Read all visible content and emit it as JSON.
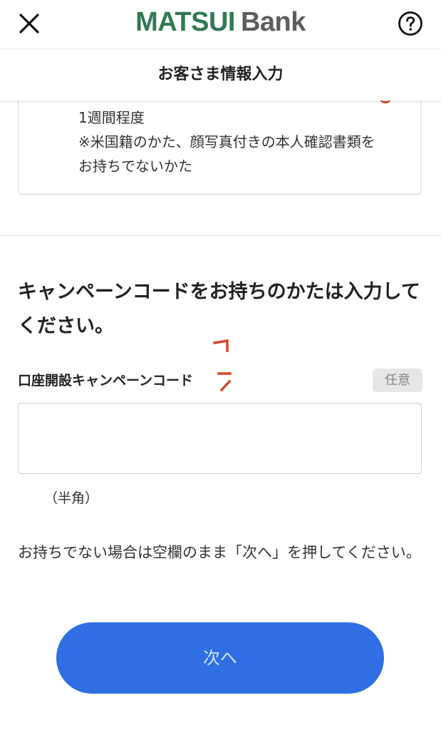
{
  "header": {
    "brand_primary": "MATSUI",
    "brand_secondary": "Bank",
    "close_icon": "close-icon",
    "help_icon": "question-circle-icon"
  },
  "title_bar": {
    "title": "お客さま情報入力"
  },
  "info_box": {
    "line1": "1週間程度",
    "line2": "※米国籍のかた、顔写真付きの本人確認書類を",
    "line3": "お持ちでないかた"
  },
  "campaign": {
    "heading": "キャンペーンコードをお持ちのかたは入力してください。",
    "field_label": "口座開設キャンペーンコード",
    "optional_badge": "任意",
    "input_value": "",
    "input_hint": "（半角）",
    "note": "お持ちでない場合は空欄のまま「次へ」を押してください。"
  },
  "actions": {
    "next_label": "次へ"
  },
  "colors": {
    "brand_green": "#2f7a52",
    "brand_gray": "#5d5d5d",
    "primary_button": "#2f6fe3",
    "marker_red": "#d8442b"
  }
}
